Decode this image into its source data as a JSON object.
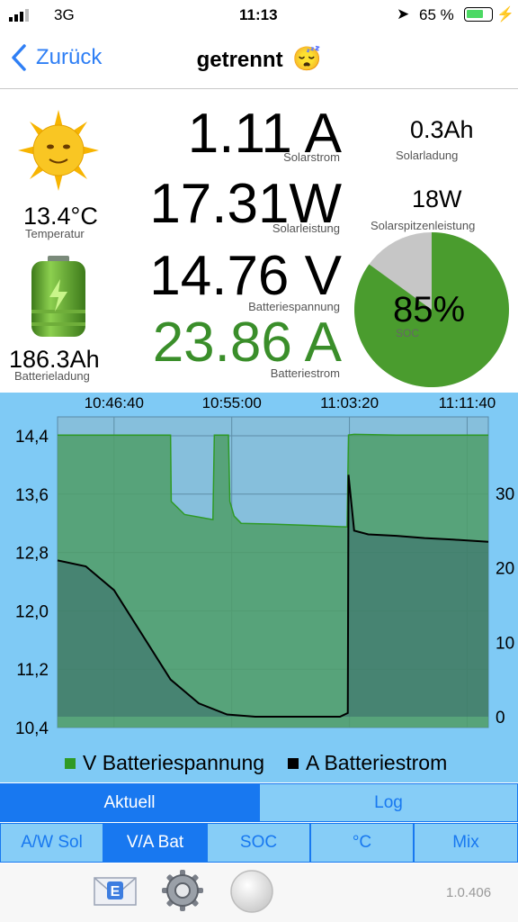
{
  "status_bar": {
    "carrier": "3G",
    "time": "11:13",
    "battery_percent": "65 %"
  },
  "nav": {
    "back_label": "Zurück",
    "title": "getrennt",
    "title_emoji": "😴"
  },
  "metrics": {
    "temperature": {
      "value": "13.4°C",
      "label": "Temperatur"
    },
    "battery_charge": {
      "value": "186.3Ah",
      "label": "Batterieladung"
    },
    "solar_current": {
      "value": "1.11 A",
      "label": "Solarstrom"
    },
    "solar_power": {
      "value": "17.31W",
      "label": "Solarleistung"
    },
    "battery_voltage": {
      "value": "14.76 V",
      "label": "Batteriespannung"
    },
    "battery_current": {
      "value": "23.86 A",
      "label": "Batteriestrom",
      "color": "#3a8e2a"
    },
    "solar_charge": {
      "value": "0.3Ah",
      "label": "Solarladung"
    },
    "solar_peak": {
      "value": "18W",
      "label": "Solarspitzenleistung"
    },
    "soc": {
      "value": "85%",
      "label": "SOC",
      "fraction": 0.85,
      "fill_color": "#4a9c2e",
      "rest_color": "#c6c6c6"
    }
  },
  "chart_data": {
    "type": "line",
    "x_tick_labels": [
      "10:46:40",
      "10:55:00",
      "11:03:20",
      "11:11:40"
    ],
    "x_ticks_minutes": [
      0,
      8.333,
      16.667,
      25
    ],
    "xlim_minutes": [
      -4,
      26.5
    ],
    "y_left": {
      "ticks": [
        "14,4",
        "13,6",
        "12,8",
        "12,0",
        "11,2",
        "10,4"
      ],
      "tick_values": [
        14.4,
        13.6,
        12.8,
        12.0,
        11.2,
        10.4
      ],
      "ylim": [
        10.4,
        14.4
      ]
    },
    "y_right": {
      "ticks": [
        "30",
        "20",
        "10",
        "0"
      ],
      "tick_values": [
        30,
        20,
        10,
        0
      ],
      "ylim": [
        0,
        30
      ]
    },
    "grid": true,
    "legend_position": "bottom",
    "series": [
      {
        "name": "V Batteriespannung",
        "axis": "left",
        "color": "#2f9a26",
        "fill": "#4f9e68",
        "x": [
          -4,
          4,
          4.05,
          5,
          7,
          7.1,
          8.1,
          8.2,
          8.5,
          8.9,
          9,
          11,
          14,
          16.5,
          16.6,
          17,
          20,
          26.5
        ],
        "y": [
          14.41,
          14.41,
          13.5,
          13.32,
          13.25,
          14.41,
          14.41,
          13.5,
          13.3,
          13.22,
          13.2,
          13.19,
          13.17,
          13.15,
          14.41,
          14.42,
          14.41,
          14.41
        ]
      },
      {
        "name": "A Batteriestrom",
        "axis": "right",
        "color": "#000000",
        "fill": "#3a6b6b",
        "x": [
          -4,
          -2,
          0,
          2,
          4,
          6,
          8,
          10,
          12,
          14,
          16,
          16.55,
          16.6,
          17,
          18,
          20,
          22,
          24,
          26.5
        ],
        "y": [
          21,
          20.2,
          17,
          11,
          5,
          1.8,
          0.3,
          0,
          0,
          0,
          0,
          0.5,
          32.5,
          25,
          24.5,
          24.3,
          24,
          23.8,
          23.5
        ]
      }
    ]
  },
  "tabs": {
    "items": [
      {
        "label": "Aktuell",
        "active": true
      },
      {
        "label": "Log",
        "active": false
      }
    ]
  },
  "subtabs": {
    "items": [
      {
        "label": "A/W Sol",
        "active": false
      },
      {
        "label": "V/A Bat",
        "active": true
      },
      {
        "label": "SOC",
        "active": false
      },
      {
        "label": "°C",
        "active": false
      },
      {
        "label": "Mix",
        "active": false
      }
    ]
  },
  "footer": {
    "version": "1.0.406",
    "icons": [
      "email-icon",
      "settings-gear-icon",
      "record-button-icon"
    ]
  }
}
